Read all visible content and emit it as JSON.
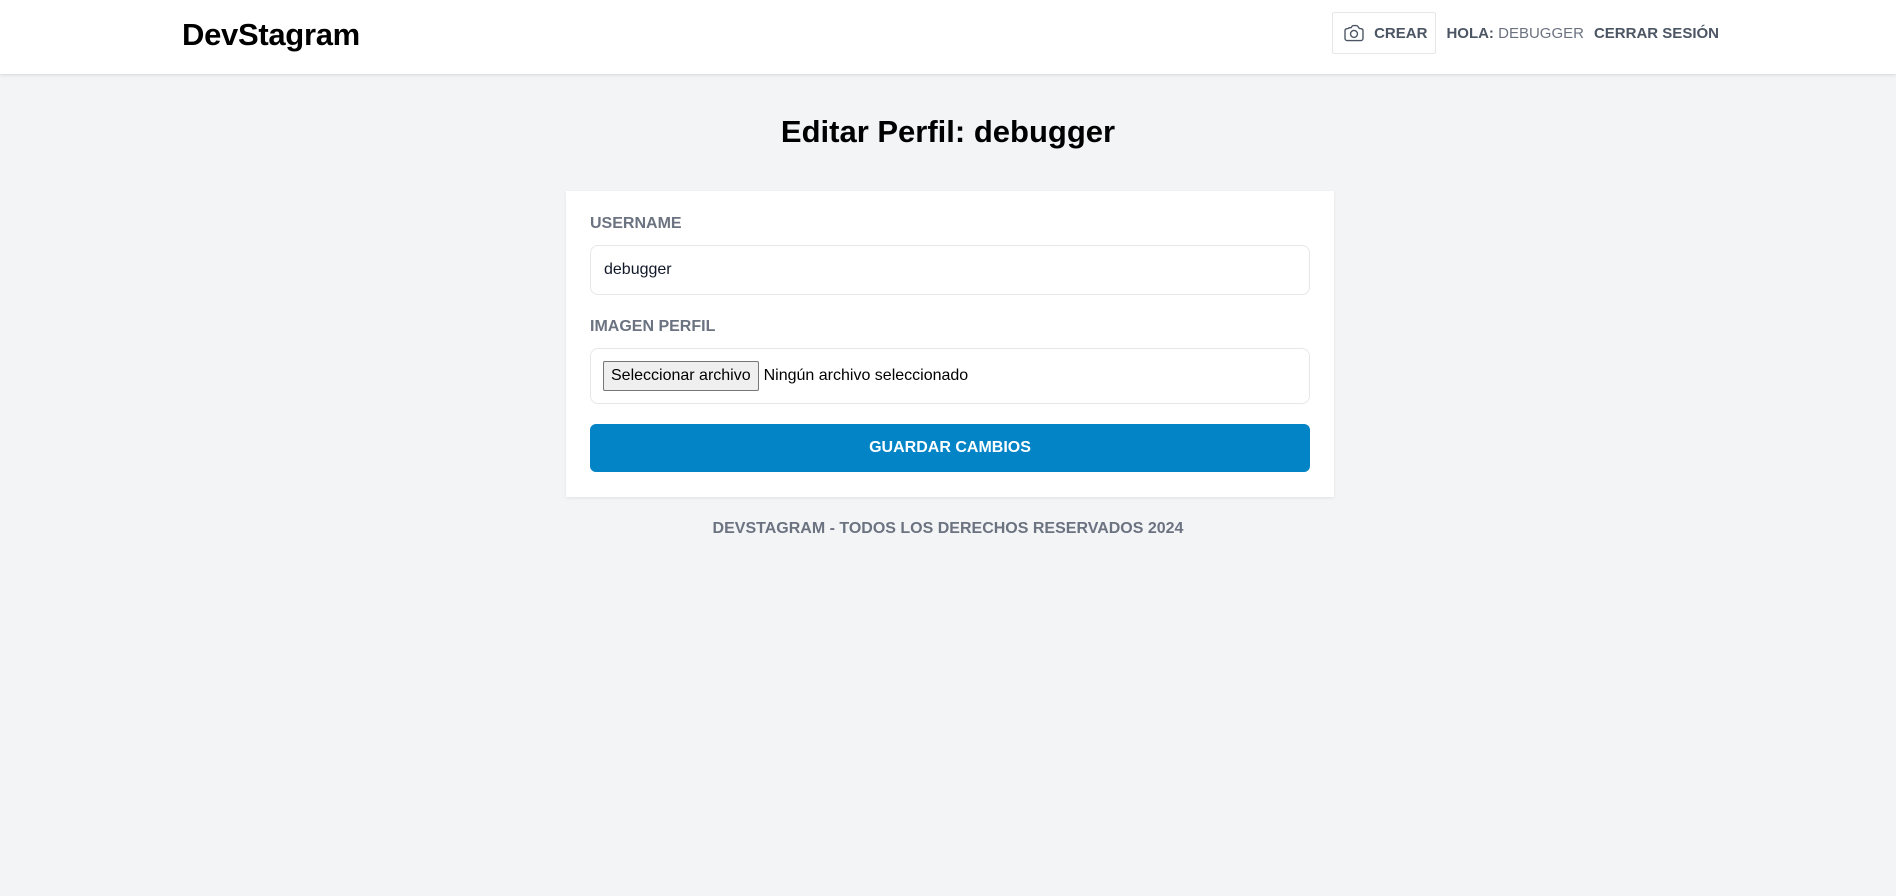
{
  "header": {
    "logo": "DevStagram",
    "create_label": "Crear",
    "hello_label": "Hola:",
    "username": "debugger",
    "logout_label": "Cerrar Sesión"
  },
  "page": {
    "title": "Editar Perfil: debugger"
  },
  "form": {
    "username_label": "Username",
    "username_value": "debugger",
    "image_label": "Imagen Perfil",
    "file_button": "Seleccionar archivo",
    "file_status": "Ningún archivo seleccionado",
    "submit_label": "Guardar Cambios"
  },
  "footer": {
    "text": "DevStagram - Todos los derechos reservados 2024"
  },
  "colors": {
    "background": "#f3f4f6",
    "accent": "#0284c7",
    "muted_text": "#6b7280"
  },
  "icons": {
    "create": "camera-icon"
  }
}
